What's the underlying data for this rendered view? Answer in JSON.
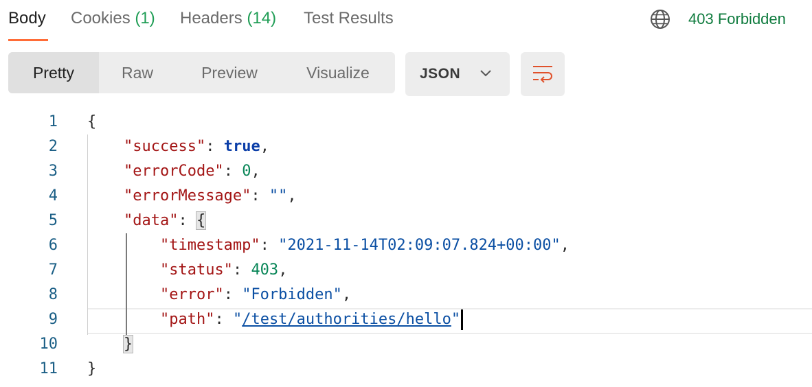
{
  "tabs": [
    {
      "label": "Body",
      "count": ""
    },
    {
      "label": "Cookies",
      "count": "(1)"
    },
    {
      "label": "Headers",
      "count": "(14)"
    },
    {
      "label": "Test Results",
      "count": ""
    }
  ],
  "status": {
    "text": "403 Forbidden",
    "icon": "globe-icon"
  },
  "view_modes": [
    "Pretty",
    "Raw",
    "Preview",
    "Visualize"
  ],
  "format": {
    "selected": "JSON"
  },
  "wrap_icon": "text-wrap-icon",
  "line_numbers": [
    "1",
    "2",
    "3",
    "4",
    "5",
    "6",
    "7",
    "8",
    "9",
    "10",
    "11"
  ],
  "json": {
    "open_brace": "{",
    "close_brace": "}",
    "success_key": "\"success\"",
    "success_val": "true",
    "errorCode_key": "\"errorCode\"",
    "errorCode_val": "0",
    "errorMessage_key": "\"errorMessage\"",
    "errorMessage_val": "\"\"",
    "data_key": "\"data\"",
    "timestamp_key": "\"timestamp\"",
    "timestamp_val": "\"2021-11-14T02:09:07.824+00:00\"",
    "status_key": "\"status\"",
    "status_val": "403",
    "error_key": "\"error\"",
    "error_val": "\"Forbidden\"",
    "path_key": "\"path\"",
    "path_val": "/test/authorities/hello"
  },
  "colors": {
    "accent": "#ff6c37",
    "success": "#0f7b3e",
    "count": "#1f9d55"
  }
}
